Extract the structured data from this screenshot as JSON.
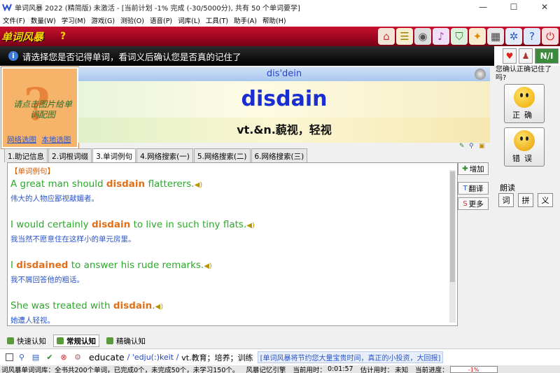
{
  "window": {
    "title": "单词风暴 2022  (精简版) 未激活 - [当前计划 -1% 完成 (-30/5000分), 共有 50 个单词要学]",
    "minimize": "—",
    "maximize": "☐",
    "close": "✕"
  },
  "menu": [
    "文件(F)",
    "数量(W)",
    "学习(M)",
    "游戏(G)",
    "测验(O)",
    "语音(P)",
    "词库(L)",
    "工具(T)",
    "助手(A)",
    "帮助(H)"
  ],
  "toolbar": {
    "logo": "单词风暴",
    "help": "?"
  },
  "instruction": {
    "icon": "i",
    "text": "请选择您是否记得单词，看词义后确认您是否真的记住了"
  },
  "right_top": {
    "nav": "N/I"
  },
  "picture": {
    "hint": "请点击图片给单词配图",
    "qmark": "?",
    "link_net": "网络选图",
    "link_local": "本地选图"
  },
  "word": {
    "phonetic": "dis'dein",
    "text": "disdain",
    "definition": "vt.&n.藐视，轻视"
  },
  "tabs": [
    "1.助记信息",
    "2.词根词缀",
    "3.单词例句",
    "4.网络搜索(一)",
    "5.网络搜索(二)",
    "6.网络搜索(三)"
  ],
  "examples": {
    "header": "【单词例句】",
    "items": [
      {
        "pre": "A great man should ",
        "kw": "disdain",
        "post": " flatterers.",
        "zh": "伟大的人物应鄙视献媚者。"
      },
      {
        "pre": "I would certainly ",
        "kw": "disdain",
        "post": " to live in such tiny flats.",
        "zh": "我当然不愿意住在这样小的单元房里。"
      },
      {
        "pre": "I ",
        "kw": "disdained",
        "post": " to answer his rude remarks.",
        "zh": "我不屑回答他的粗话。"
      },
      {
        "pre": "She was treated with ",
        "kw": "disdain",
        "post": ".",
        "zh": "她遭人轻视。"
      }
    ]
  },
  "side_buttons": {
    "add": "增加",
    "translate": "翻译",
    "more": "更多"
  },
  "confirm": {
    "question": "您确认正确记住了吗?",
    "correct": "正确",
    "wrong": "错误",
    "read_label": "朗读",
    "read_word": "词",
    "read_spell": "拼",
    "read_meaning": "义"
  },
  "modes": [
    "快速认知",
    "常规认知",
    "精确认知"
  ],
  "bottom": {
    "word": "educate",
    "phonetic": "/ 'edju(:)keit /",
    "definition": "vt.教育；培养；训练",
    "ad": "[单词风暴将节约您大量宝贵时间，真正的小投资，大回报]"
  },
  "status": {
    "left": "词风暴单词词库：全书共200个单词，已完成0个，未完成50个，未学习150个。",
    "engine": "风暴记忆引擎",
    "time_label": "当前用时：",
    "time": "0:01:57",
    "est_label": "估计用时：",
    "est": "未知",
    "progress_label": "当前进度：",
    "progress": "-1%"
  }
}
